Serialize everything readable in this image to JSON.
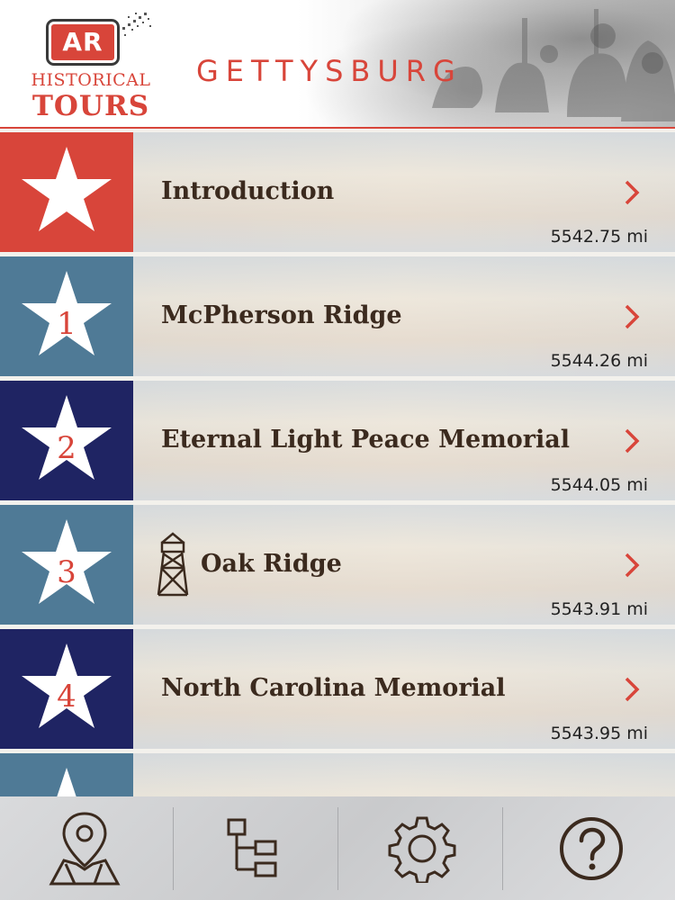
{
  "header": {
    "logo_badge": "AR",
    "logo_line1": "HISTORICAL",
    "logo_line2": "TOURS",
    "title": "GETTYSBURG"
  },
  "colors": {
    "red": "#d8453a",
    "steel_blue": "#4f7a96",
    "navy": "#1f2463",
    "text_brown": "#3b2a1e"
  },
  "tour_stops": [
    {
      "badge": "",
      "label": "Introduction",
      "distance": "5542.75 mi",
      "badge_color": "#d8453a",
      "icon": "star-icon"
    },
    {
      "badge": "1",
      "label": "McPherson Ridge",
      "distance": "5544.26 mi",
      "badge_color": "#4f7a96",
      "icon": "star-icon"
    },
    {
      "badge": "2",
      "label": "Eternal Light Peace Memorial",
      "distance": "5544.05 mi",
      "badge_color": "#1f2463",
      "icon": "star-icon"
    },
    {
      "badge": "3",
      "label": "Oak Ridge",
      "distance": "5543.91 mi",
      "badge_color": "#4f7a96",
      "icon": "star-icon",
      "extra_icon": "observation-tower-icon"
    },
    {
      "badge": "4",
      "label": "North Carolina Memorial",
      "distance": "5543.95 mi",
      "badge_color": "#1f2463",
      "icon": "star-icon"
    },
    {
      "badge": "",
      "label": "",
      "distance": "",
      "badge_color": "#4f7a96",
      "icon": "star-icon"
    }
  ],
  "bottom_nav": [
    {
      "name": "map",
      "icon": "map-pin-icon"
    },
    {
      "name": "tour-list",
      "icon": "list-tree-icon"
    },
    {
      "name": "settings",
      "icon": "gear-icon"
    },
    {
      "name": "help",
      "icon": "help-icon"
    }
  ]
}
